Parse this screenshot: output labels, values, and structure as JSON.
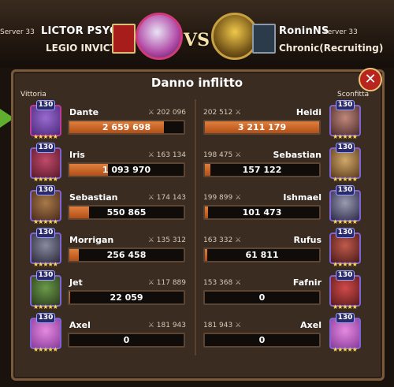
{
  "header": {
    "vs": "VS",
    "left": {
      "server": "Server 33",
      "name": "LICTOR PSYCHO",
      "guild": "LEGIO INVICTA"
    },
    "right": {
      "server": "Server 33",
      "name": "RoninNS",
      "guild": "Chronic(Recruiting)"
    }
  },
  "panel": {
    "title": "Danno inflitto",
    "left_label": "Vittoria",
    "right_label": "Sconfitta",
    "close": "✕"
  },
  "left_heroes": [
    {
      "name": "Dante",
      "level": "130",
      "power": "202 096",
      "damage": "2 659 698",
      "fill": 0.83
    },
    {
      "name": "Iris",
      "level": "130",
      "power": "163 134",
      "damage": "1 093 970",
      "fill": 0.34
    },
    {
      "name": "Sebastian",
      "level": "130",
      "power": "174 143",
      "damage": "550 865",
      "fill": 0.17
    },
    {
      "name": "Morrigan",
      "level": "130",
      "power": "135 312",
      "damage": "256 458",
      "fill": 0.08
    },
    {
      "name": "Jet",
      "level": "130",
      "power": "117 889",
      "damage": "22 059",
      "fill": 0.01
    },
    {
      "name": "Axel",
      "level": "130",
      "power": "181 943",
      "damage": "0",
      "fill": 0
    }
  ],
  "right_heroes": [
    {
      "name": "Heidi",
      "level": "130",
      "power": "202 512",
      "damage": "3 211 179",
      "fill": 1.0
    },
    {
      "name": "Sebastian",
      "level": "130",
      "power": "198 475",
      "damage": "157 122",
      "fill": 0.05
    },
    {
      "name": "Ishmael",
      "level": "130",
      "power": "199 899",
      "damage": "101 473",
      "fill": 0.03
    },
    {
      "name": "Rufus",
      "level": "130",
      "power": "163 332",
      "damage": "61 811",
      "fill": 0.02
    },
    {
      "name": "Fafnir",
      "level": "130",
      "power": "153 368",
      "damage": "0",
      "fill": 0
    },
    {
      "name": "Axel",
      "level": "130",
      "power": "181 943",
      "damage": "0",
      "fill": 0
    }
  ],
  "colors": {
    "bar_fill": "#d0692a",
    "accent_gold": "#ffd84d",
    "close_red": "#b8251f"
  },
  "icons": {
    "power": "crossed-swords-icon",
    "close": "close-icon"
  }
}
